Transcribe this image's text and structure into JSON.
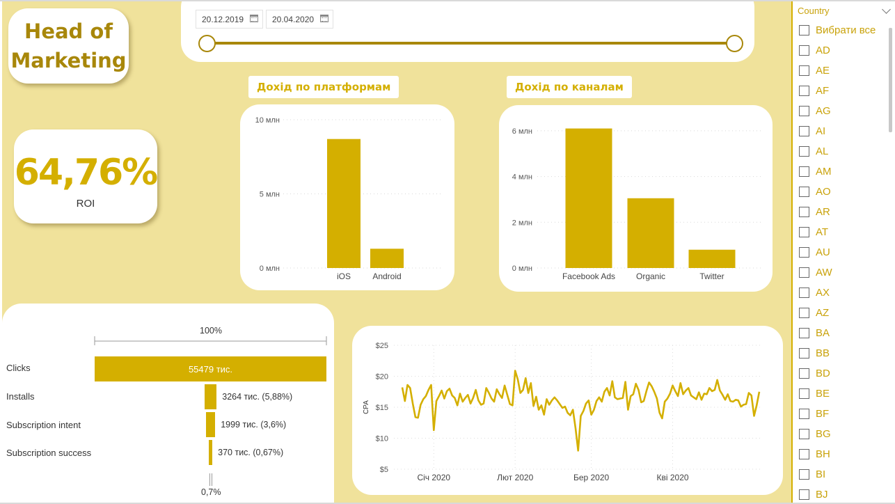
{
  "title": "Head of\nMarketing",
  "roi": {
    "value": "64,76%",
    "label": "ROI"
  },
  "date_range": {
    "start": "20.12.2019",
    "end": "20.04.2020"
  },
  "platform_chart": {
    "header": "Дохід по платформам",
    "chart_data": {
      "type": "bar",
      "categories": [
        "iOS",
        "Android"
      ],
      "values": [
        8.7,
        1.3
      ],
      "ylim": [
        0,
        10
      ],
      "y_ticks": [
        0,
        5,
        10
      ],
      "y_tick_labels": [
        "0 млн",
        "5 млн",
        "10 млн"
      ]
    }
  },
  "channel_chart": {
    "header": "Дохід по каналам",
    "chart_data": {
      "type": "bar",
      "categories": [
        "Facebook Ads",
        "Organic",
        "Twitter"
      ],
      "values": [
        6.1,
        3.05,
        0.8
      ],
      "ylim": [
        0,
        7
      ],
      "y_ticks": [
        0,
        2,
        4,
        6
      ],
      "y_tick_labels": [
        "0 млн",
        "2 млн",
        "4 млн",
        "6 млн"
      ]
    }
  },
  "funnel": {
    "top_label": "100%",
    "bottom_label": "0,7%",
    "stages": [
      {
        "label": "Clicks",
        "value_text": "55479 тис.",
        "fraction": 1.0
      },
      {
        "label": "Installs",
        "value_text": "3264 тис. (5,88%)",
        "fraction": 0.0588
      },
      {
        "label": "Subscription intent",
        "value_text": "1999 тис. (3,6%)",
        "fraction": 0.036
      },
      {
        "label": "Subscription success",
        "value_text": "370 тис. (0,67%)",
        "fraction": 0.0067
      }
    ]
  },
  "cpa_chart": {
    "chart_data": {
      "type": "line",
      "ylabel": "CPA",
      "ylim": [
        5,
        25
      ],
      "y_ticks": [
        5,
        10,
        15,
        20,
        25
      ],
      "y_tick_labels": [
        "$5",
        "$10",
        "$15",
        "$20",
        "$25"
      ],
      "x_start": "2019-12-20",
      "x_tick_labels": [
        "Січ 2020",
        "Лют 2020",
        "Бер 2020",
        "Кві 2020"
      ],
      "x_tick_dates": [
        "2020-01-01",
        "2020-02-01",
        "2020-03-01",
        "2020-04-01"
      ],
      "values": [
        18.2,
        16,
        18.6,
        18.1,
        15.6,
        13.4,
        13.3,
        15.4,
        16.3,
        16.8,
        17.8,
        18.6,
        11.3,
        16,
        16.8,
        17.7,
        16.4,
        17.6,
        18,
        16.9,
        16.5,
        15.3,
        17.2,
        15.9,
        16.5,
        17,
        15.6,
        16.5,
        17.8,
        16.1,
        15.4,
        15.6,
        18.1,
        17.3,
        16.4,
        15.9,
        17.9,
        17.1,
        16.5,
        18.5,
        17,
        15.5,
        15.3,
        20.9,
        19.5,
        17.3,
        17.8,
        19.7,
        17.3,
        18.9,
        15.2,
        16.7,
        14.6,
        15.3,
        13.8,
        16.3,
        15.4,
        16.1,
        16.6,
        16.1,
        15.5,
        14.9,
        15.1,
        14.1,
        13.7,
        14.6,
        11.6,
        8,
        13.6,
        14.4,
        15.6,
        16.1,
        13.8,
        14.6,
        16,
        16.6,
        15.9,
        17.5,
        18.1,
        16.9,
        19.2,
        16.6,
        16.3,
        16.4,
        16.5,
        19.1,
        14.6,
        16.8,
        17.1,
        18.8,
        17.8,
        15.8,
        16,
        17.6,
        19,
        18.4,
        17.5,
        16.4,
        14.1,
        13.2,
        15.9,
        16.4,
        17.2,
        18.5,
        17.6,
        16.8,
        18.9,
        17.1,
        17.7,
        18.1,
        16.9,
        16.6,
        16.3,
        17.4,
        16.2,
        17.2,
        17.1,
        18.1,
        17.6,
        17.8,
        19.4,
        17.7,
        17,
        16.2,
        17.1,
        16,
        15.9,
        16.2,
        16.1,
        15.1,
        15.4,
        15.5,
        17.3,
        16.9,
        13.6,
        15.3,
        17.5
      ]
    }
  },
  "country_slicer": {
    "title": "Country",
    "items": [
      "Вибрати все",
      "AD",
      "AE",
      "AF",
      "AG",
      "AI",
      "AL",
      "AM",
      "AO",
      "AR",
      "AT",
      "AU",
      "AW",
      "AX",
      "AZ",
      "BA",
      "BB",
      "BD",
      "BE",
      "BF",
      "BG",
      "BH",
      "BI",
      "BJ"
    ]
  },
  "colors": {
    "accent": "#d4af00",
    "title": "#a8870a",
    "canvas": "#f0e29b"
  }
}
